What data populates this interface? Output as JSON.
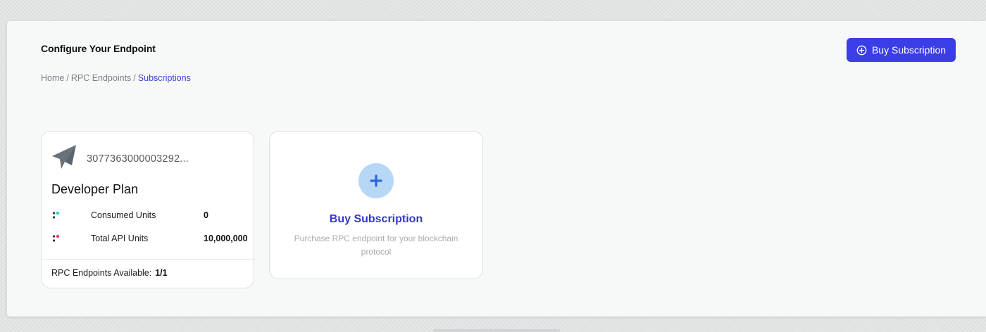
{
  "header": {
    "title": "Configure Your Endpoint",
    "breadcrumb": [
      "Home",
      "RPC Endpoints",
      "Subscriptions"
    ],
    "breadcrumb_separator": "/",
    "buy_button": {
      "label": "Buy Subscription",
      "icon": "plus-circle-icon",
      "color": "#3b3ee6"
    }
  },
  "subscription_card": {
    "icon": "paper-plane-icon",
    "subscription_id": "3077363000003292...",
    "plan_name": "Developer Plan",
    "stats": [
      {
        "label": "Consumed Units",
        "value": "0",
        "icon": "dots-cyan-icon",
        "accent": "#19d3c5"
      },
      {
        "label": "Total API Units",
        "value": "10,000,000",
        "icon": "dots-pink-icon",
        "accent": "#f0357a"
      }
    ],
    "footer": {
      "label": "RPC Endpoints Available:",
      "value": "1/1"
    }
  },
  "add_card": {
    "icon": "plus-icon",
    "title": "Buy Subscription",
    "description": "Purchase RPC endpoint for your blockchain protocol",
    "accent": "#3438c6"
  }
}
